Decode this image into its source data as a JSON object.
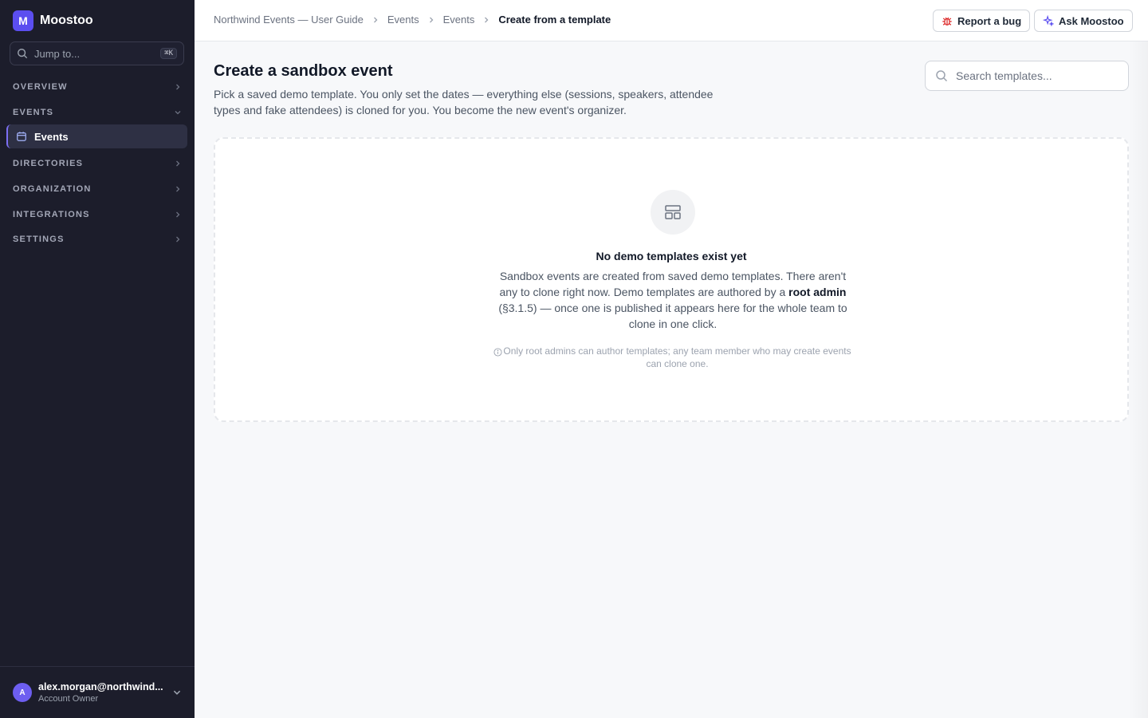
{
  "app": {
    "logo_letter": "M",
    "name": "Moostoo"
  },
  "sidebar": {
    "jump_placeholder": "Jump to...",
    "jump_shortcut": "⌘K",
    "sections": [
      {
        "label": "OVERVIEW",
        "expanded": false
      },
      {
        "label": "EVENTS",
        "expanded": true
      },
      {
        "label": "DIRECTORIES",
        "expanded": false
      },
      {
        "label": "ORGANIZATION",
        "expanded": false
      },
      {
        "label": "INTEGRATIONS",
        "expanded": false
      },
      {
        "label": "SETTINGS",
        "expanded": false
      }
    ],
    "active_item": {
      "label": "Events",
      "icon": "calendar-icon"
    }
  },
  "user": {
    "avatar_letter": "A",
    "email": "alex.morgan@northwind...",
    "role": "Account Owner"
  },
  "breadcrumb": [
    "Northwind Events — User Guide",
    "Events",
    "Events",
    "Create from a template"
  ],
  "topbar": {
    "report_bug": "Report a bug",
    "ask": "Ask Moostoo"
  },
  "page": {
    "title": "Create a sandbox event",
    "description": "Pick a saved demo template. You only set the dates — everything else (sessions, speakers, attendee types and fake attendees) is cloned for you. You become the new event's organizer.",
    "search_placeholder": "Search templates..."
  },
  "empty_state": {
    "title": "No demo templates exist yet",
    "body_1": "Sandbox events are created from saved demo templates. There aren't any to clone right now. Demo templates are authored by a",
    "body_bold": "root admin",
    "body_2": "(§3.1.5) — once one is published it appears here for the whole team to clone in one click.",
    "note": "Only root admins can author templates; any team member who may create events can clone one."
  },
  "colors": {
    "sidebar_bg": "#1c1d2b",
    "accent": "#5b4ef0",
    "bug_icon": "#dc2626",
    "ask_icon": "#5b4ef0"
  }
}
